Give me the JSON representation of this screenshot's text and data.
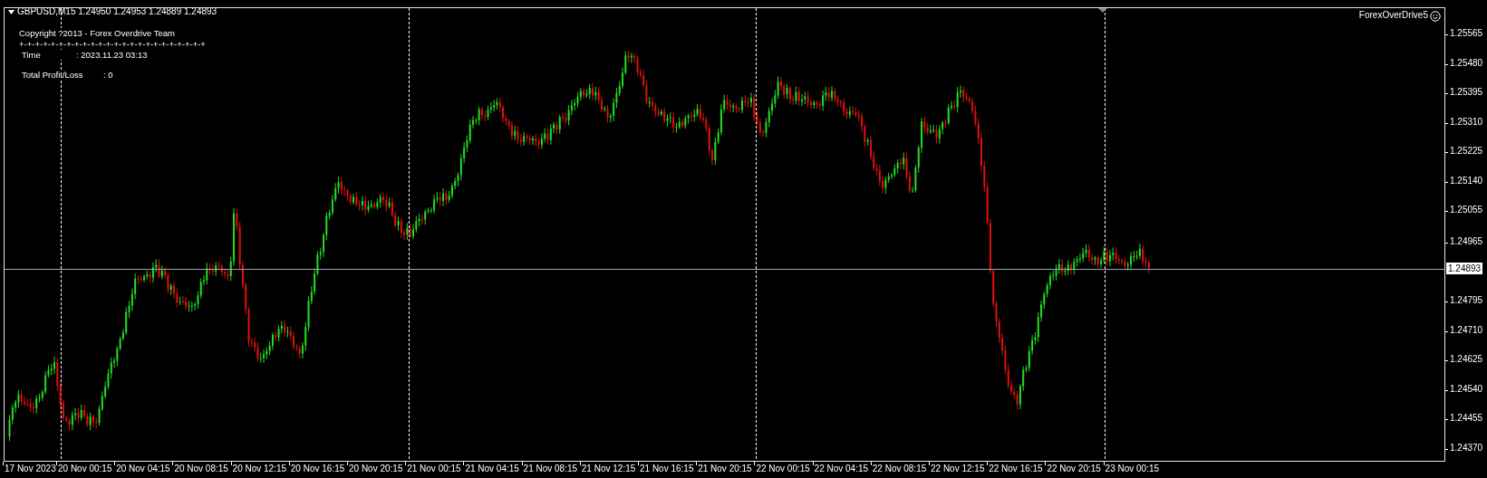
{
  "chart": {
    "symbol_line": "GBPUSD,M15  1.24950 1.24953 1.24889 1.24893",
    "indicator_name": "ForexOverDrive5",
    "info_panel": {
      "copyright": "Copyright ?2013 - Forex Overdrive Team",
      "separator": "+-+-+-+-+-+-+-+-+-+-+-+-+-+-+-+-+-+-+-+-+-+-+-+",
      "time_label": "Time",
      "time_value": ": 2023.11.23 03:13",
      "pl_label": "Total Profit/Loss",
      "pl_value": ": 0"
    },
    "price_ticks": [
      "1.25565",
      "1.25480",
      "1.25395",
      "1.25310",
      "1.25225",
      "1.25140",
      "1.25055",
      "1.24965",
      "1.24795",
      "1.24710",
      "1.24625",
      "1.24540",
      "1.24455",
      "1.24370"
    ],
    "current_price": "1.24893",
    "time_ticks": [
      "17 Nov 2023",
      "20 Nov 00:15",
      "20 Nov 04:15",
      "20 Nov 08:15",
      "20 Nov 12:15",
      "20 Nov 16:15",
      "20 Nov 20:15",
      "21 Nov 00:15",
      "21 Nov 04:15",
      "21 Nov 08:15",
      "21 Nov 12:15",
      "21 Nov 16:15",
      "21 Nov 20:15",
      "22 Nov 00:15",
      "22 Nov 04:15",
      "22 Nov 08:15",
      "22 Nov 12:15",
      "22 Nov 16:15",
      "22 Nov 20:15",
      "23 Nov 00:15"
    ]
  }
}
